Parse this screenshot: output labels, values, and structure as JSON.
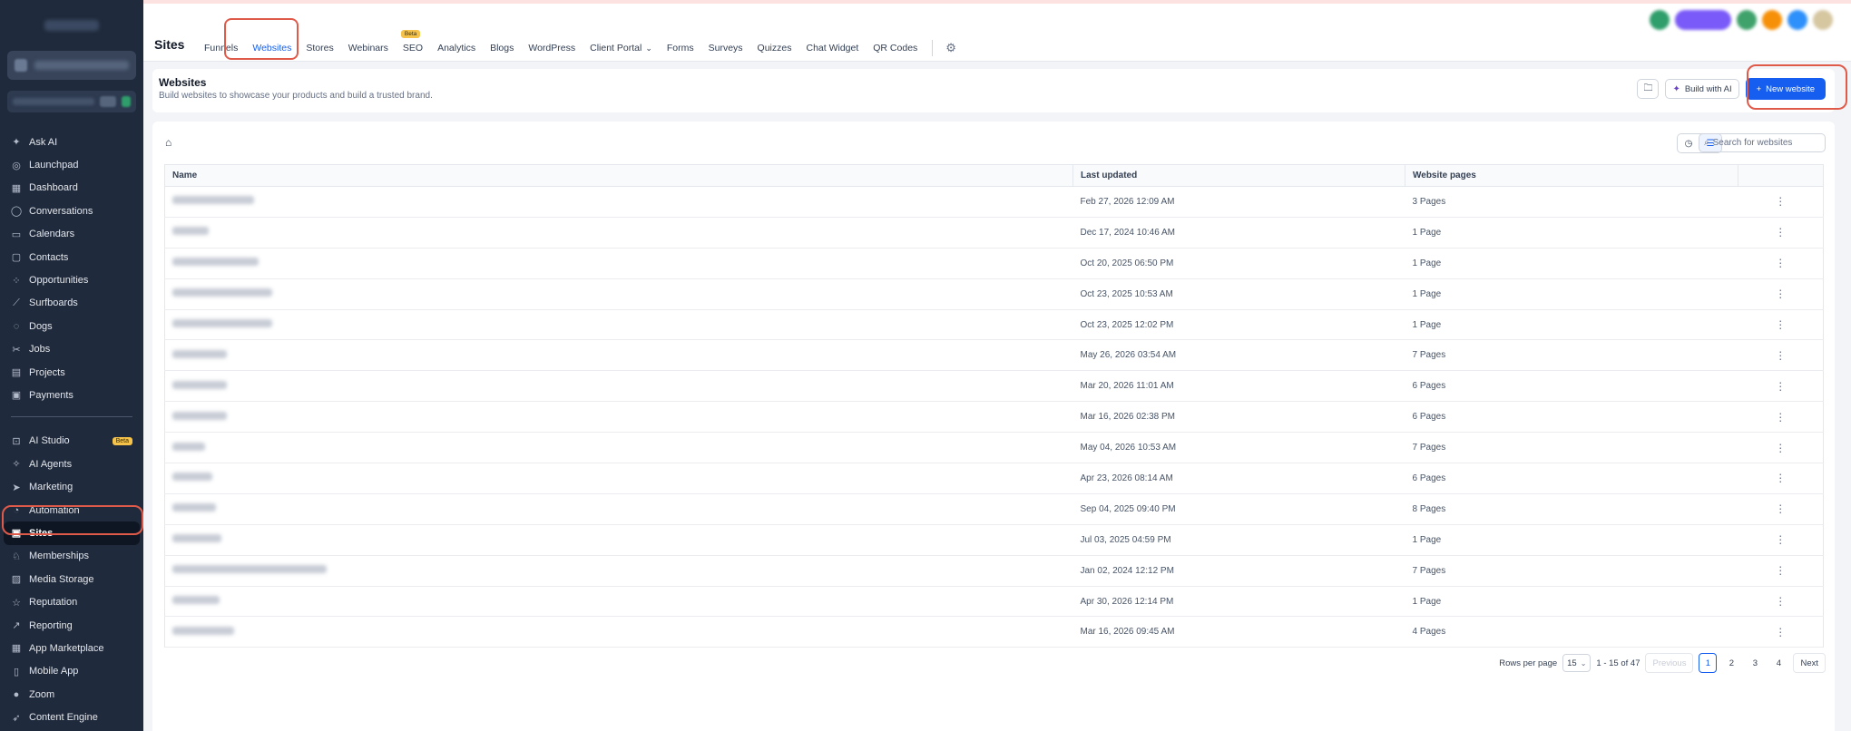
{
  "sidebar": {
    "items": [
      {
        "label": "Ask AI",
        "icon": "✦"
      },
      {
        "label": "Launchpad",
        "icon": "◎"
      },
      {
        "label": "Dashboard",
        "icon": "▦"
      },
      {
        "label": "Conversations",
        "icon": "◯"
      },
      {
        "label": "Calendars",
        "icon": "▭"
      },
      {
        "label": "Contacts",
        "icon": "▢"
      },
      {
        "label": "Opportunities",
        "icon": "⁘"
      },
      {
        "label": "Surfboards",
        "icon": "⟋"
      },
      {
        "label": "Dogs",
        "icon": "◌"
      },
      {
        "label": "Jobs",
        "icon": "✂"
      },
      {
        "label": "Projects",
        "icon": "▤"
      },
      {
        "label": "Payments",
        "icon": "▣"
      }
    ],
    "items2": [
      {
        "label": "AI Studio",
        "icon": "⊡",
        "badge": "Beta"
      },
      {
        "label": "AI Agents",
        "icon": "✧"
      },
      {
        "label": "Marketing",
        "icon": "➤"
      },
      {
        "label": "Automation",
        "icon": "◔"
      },
      {
        "label": "Sites",
        "icon": "▣",
        "active": true
      },
      {
        "label": "Memberships",
        "icon": "♘"
      },
      {
        "label": "Media Storage",
        "icon": "▨"
      },
      {
        "label": "Reputation",
        "icon": "☆"
      },
      {
        "label": "Reporting",
        "icon": "↗"
      },
      {
        "label": "App Marketplace",
        "icon": "▦"
      },
      {
        "label": "Mobile App",
        "icon": "▯"
      },
      {
        "label": "Zoom",
        "icon": "●"
      },
      {
        "label": "Content Engine",
        "icon": "➶"
      }
    ]
  },
  "header": {
    "title": "Sites",
    "tabs": [
      {
        "label": "Funnels"
      },
      {
        "label": "Websites",
        "active": true
      },
      {
        "label": "Stores"
      },
      {
        "label": "Webinars"
      },
      {
        "label": "SEO",
        "badge": "Beta"
      },
      {
        "label": "Analytics"
      },
      {
        "label": "Blogs"
      },
      {
        "label": "WordPress"
      },
      {
        "label": "Client Portal",
        "dropdown": true
      },
      {
        "label": "Forms"
      },
      {
        "label": "Surveys"
      },
      {
        "label": "Quizzes"
      },
      {
        "label": "Chat Widget"
      },
      {
        "label": "QR Codes"
      }
    ]
  },
  "page": {
    "title": "Websites",
    "subtitle": "Build websites to showcase your products and build a trusted brand.",
    "build_ai_label": "Build with AI",
    "new_website_label": "New website"
  },
  "search": {
    "placeholder": "Search for websites"
  },
  "table": {
    "columns": [
      "Name",
      "Last updated",
      "Website pages",
      ""
    ],
    "rows": [
      {
        "updated": "Feb 27, 2026 12:09 AM",
        "pages": "3 Pages",
        "name_w": 90
      },
      {
        "updated": "Dec 17, 2024 10:46 AM",
        "pages": "1 Page",
        "name_w": 40
      },
      {
        "updated": "Oct 20, 2025 06:50 PM",
        "pages": "1 Page",
        "name_w": 95
      },
      {
        "updated": "Oct 23, 2025 10:53 AM",
        "pages": "1 Page",
        "name_w": 110
      },
      {
        "updated": "Oct 23, 2025 12:02 PM",
        "pages": "1 Page",
        "name_w": 110
      },
      {
        "updated": "May 26, 2026 03:54 AM",
        "pages": "7 Pages",
        "name_w": 60
      },
      {
        "updated": "Mar 20, 2026 11:01 AM",
        "pages": "6 Pages",
        "name_w": 60
      },
      {
        "updated": "Mar 16, 2026 02:38 PM",
        "pages": "6 Pages",
        "name_w": 60
      },
      {
        "updated": "May 04, 2026 10:53 AM",
        "pages": "7 Pages",
        "name_w": 36
      },
      {
        "updated": "Apr 23, 2026 08:14 AM",
        "pages": "6 Pages",
        "name_w": 44
      },
      {
        "updated": "Sep 04, 2025 09:40 PM",
        "pages": "8 Pages",
        "name_w": 48
      },
      {
        "updated": "Jul 03, 2025 04:59 PM",
        "pages": "1 Page",
        "name_w": 54
      },
      {
        "updated": "Jan 02, 2024 12:12 PM",
        "pages": "7 Pages",
        "name_w": 170
      },
      {
        "updated": "Apr 30, 2026 12:14 PM",
        "pages": "1 Page",
        "name_w": 52
      },
      {
        "updated": "Mar 16, 2026 09:45 AM",
        "pages": "4 Pages",
        "name_w": 68
      }
    ]
  },
  "pagination": {
    "rows_per_page_label": "Rows per page",
    "rows_per_page": "15",
    "range": "1 - 15 of 47",
    "previous": "Previous",
    "next": "Next",
    "pages": [
      "1",
      "2",
      "3",
      "4"
    ],
    "current": "1"
  },
  "colors": {
    "accent": "#155eef",
    "sidebar_bg": "#1f2a3c",
    "highlight": "#e05a4a"
  }
}
